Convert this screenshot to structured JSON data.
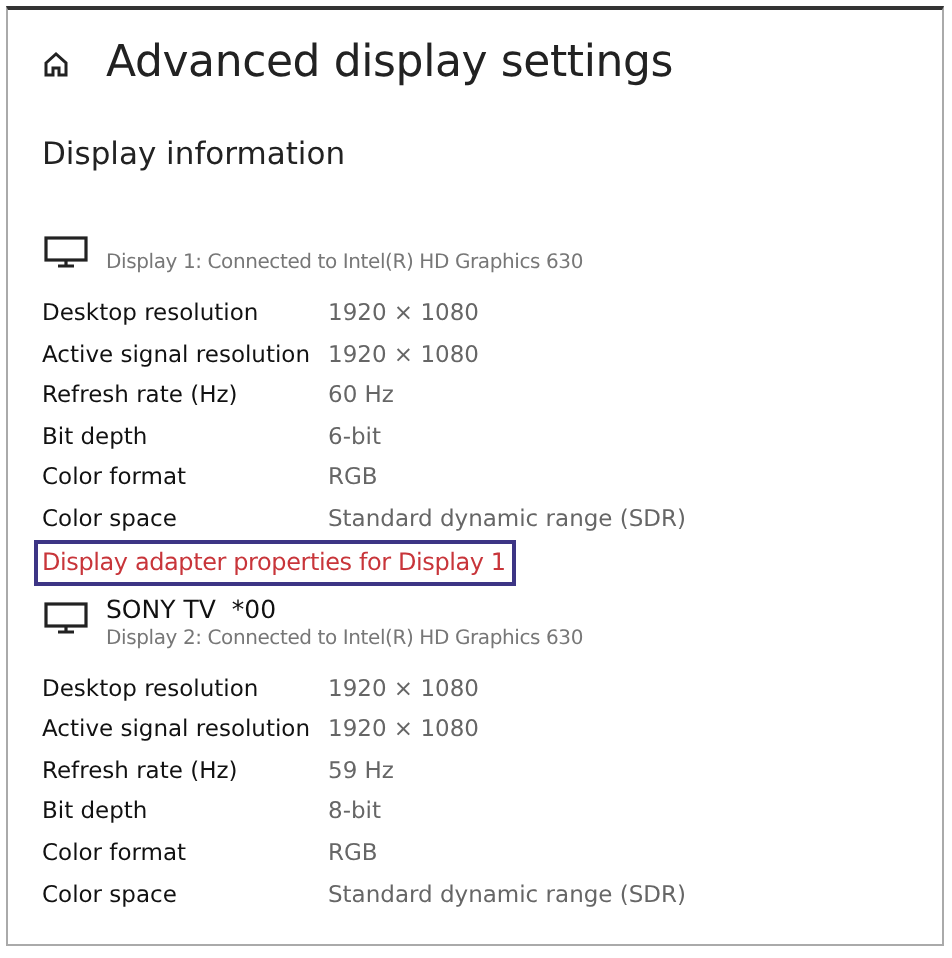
{
  "page": {
    "title": "Advanced display settings",
    "section_heading": "Display information"
  },
  "displays": [
    {
      "connection": "Display 1: Connected to Intel(R) HD Graphics 630",
      "properties": [
        {
          "label": "Desktop resolution",
          "value": "1920 × 1080"
        },
        {
          "label": "Active signal resolution",
          "value": "1920 × 1080"
        },
        {
          "label": "Refresh rate (Hz)",
          "value": "60 Hz"
        },
        {
          "label": "Bit depth",
          "value": "6-bit"
        },
        {
          "label": "Color format",
          "value": "RGB"
        },
        {
          "label": "Color space",
          "value": "Standard dynamic range (SDR)"
        }
      ],
      "adapter_link": {
        "text": "Display adapter properties for Display 1",
        "highlighted": true
      }
    },
    {
      "name": "SONY TV  *00",
      "connection": "Display 2: Connected to Intel(R) HD Graphics 630",
      "properties": [
        {
          "label": "Desktop resolution",
          "value": "1920 × 1080"
        },
        {
          "label": "Active signal resolution",
          "value": "1920 × 1080"
        },
        {
          "label": "Refresh rate (Hz)",
          "value": "59 Hz"
        },
        {
          "label": "Bit depth",
          "value": "8-bit"
        },
        {
          "label": "Color format",
          "value": "RGB"
        },
        {
          "label": "Color space",
          "value": "Standard dynamic range (SDR)"
        }
      ]
    }
  ]
}
